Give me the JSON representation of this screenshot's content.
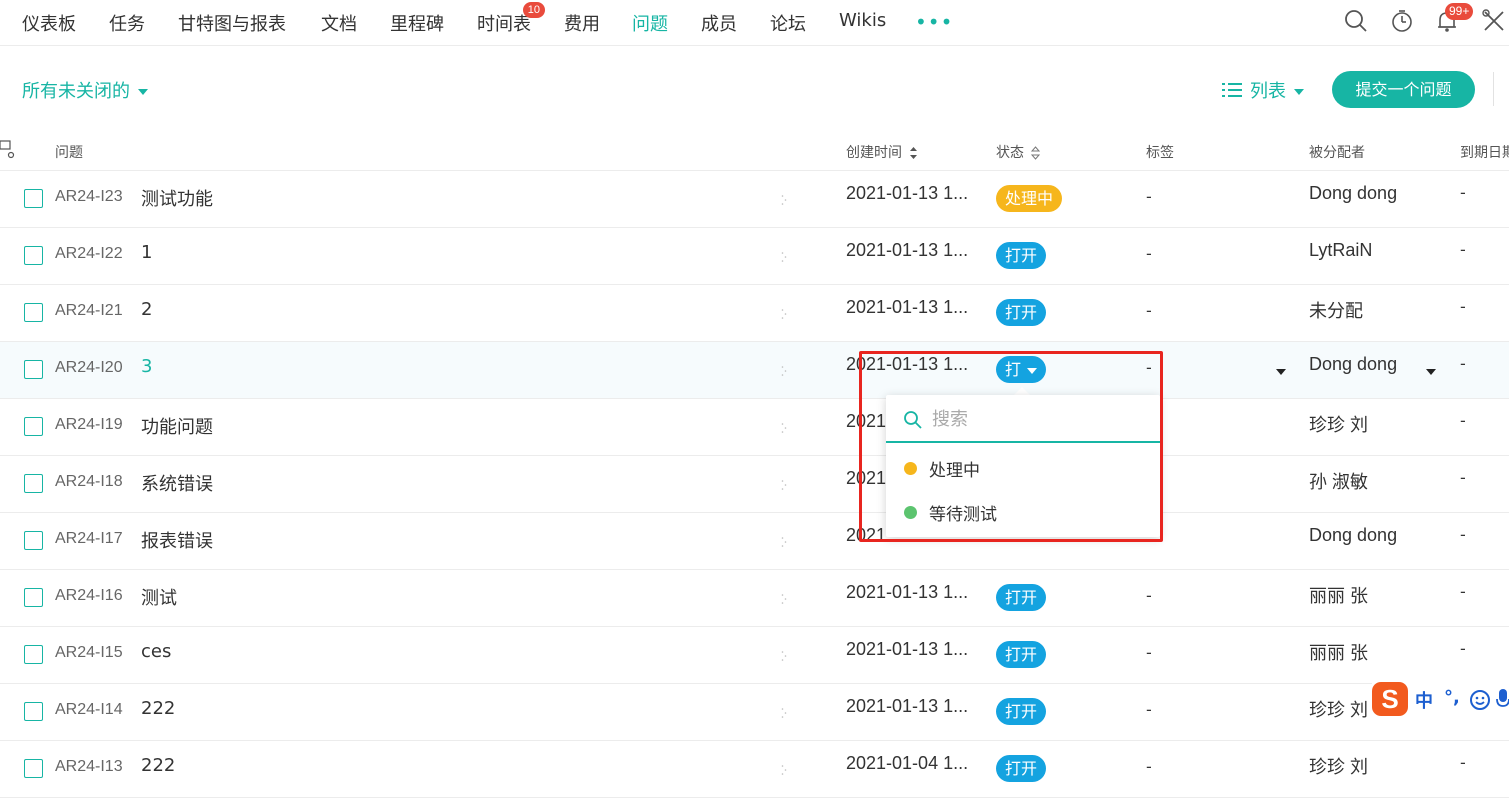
{
  "nav": {
    "items": [
      "仪表板",
      "任务",
      "甘特图与报表",
      "文档",
      "里程碑",
      "时间表",
      "费用",
      "问题",
      "成员",
      "论坛",
      "Wikis"
    ],
    "timesheet_badge": "10",
    "more": "•••",
    "notif_badge": "99+"
  },
  "toolbar": {
    "filter_label": "所有未关闭的",
    "view_label": "列表",
    "submit_label": "提交一个问题"
  },
  "table": {
    "headers": {
      "issue": "问题",
      "created": "创建时间",
      "status": "状态",
      "tags": "标签",
      "assignee": "被分配者",
      "due": "到期日期"
    },
    "rows": [
      {
        "key": "AR24-I23",
        "title": "测试功能",
        "created": "2021-01-13 1...",
        "status": "处理中",
        "tags": "-",
        "assignee": "Dong dong",
        "due": "-"
      },
      {
        "key": "AR24-I22",
        "title": "1",
        "created": "2021-01-13 1...",
        "status": "打开",
        "tags": "-",
        "assignee": "LytRaiN",
        "due": "-"
      },
      {
        "key": "AR24-I21",
        "title": "2",
        "created": "2021-01-13 1...",
        "status": "打开",
        "tags": "-",
        "assignee": "未分配",
        "due": "-"
      },
      {
        "key": "AR24-I20",
        "title": "3",
        "created": "2021-01-13 1...",
        "status": "打",
        "tags": "-",
        "assignee": "Dong dong",
        "due": "-"
      },
      {
        "key": "AR24-I19",
        "title": "功能问题",
        "created": "2021",
        "status": "",
        "tags": "",
        "assignee": "珍珍 刘",
        "due": "-"
      },
      {
        "key": "AR24-I18",
        "title": "系统错误",
        "created": "2021",
        "status": "",
        "tags": "",
        "assignee": "孙 淑敏",
        "due": "-"
      },
      {
        "key": "AR24-I17",
        "title": "报表错误",
        "created": "2021",
        "status": "",
        "tags": "",
        "assignee": "Dong dong",
        "due": "-"
      },
      {
        "key": "AR24-I16",
        "title": "测试",
        "created": "2021-01-13 1...",
        "status": "打开",
        "tags": "-",
        "assignee": "丽丽 张",
        "due": "-"
      },
      {
        "key": "AR24-I15",
        "title": "ces",
        "created": "2021-01-13 1...",
        "status": "打开",
        "tags": "-",
        "assignee": "丽丽 张",
        "due": "-"
      },
      {
        "key": "AR24-I14",
        "title": "222",
        "created": "2021-01-13 1...",
        "status": "打开",
        "tags": "-",
        "assignee": "珍珍 刘",
        "due": ""
      },
      {
        "key": "AR24-I13",
        "title": "222",
        "created": "2021-01-04 1...",
        "status": "打开",
        "tags": "-",
        "assignee": "珍珍 刘",
        "due": "-"
      }
    ]
  },
  "status_dropdown": {
    "search_placeholder": "搜索",
    "options": [
      {
        "label": "处理中",
        "color": "#f6b61c"
      },
      {
        "label": "等待测试",
        "color": "#5cc46f"
      }
    ]
  },
  "ime": {
    "logo": "S",
    "mode": "中",
    "punct": "°,"
  },
  "colors": {
    "accent": "#17b5a4",
    "open": "#14a3e0",
    "in_progress": "#f6b61c",
    "highlight": "#e8251f"
  }
}
